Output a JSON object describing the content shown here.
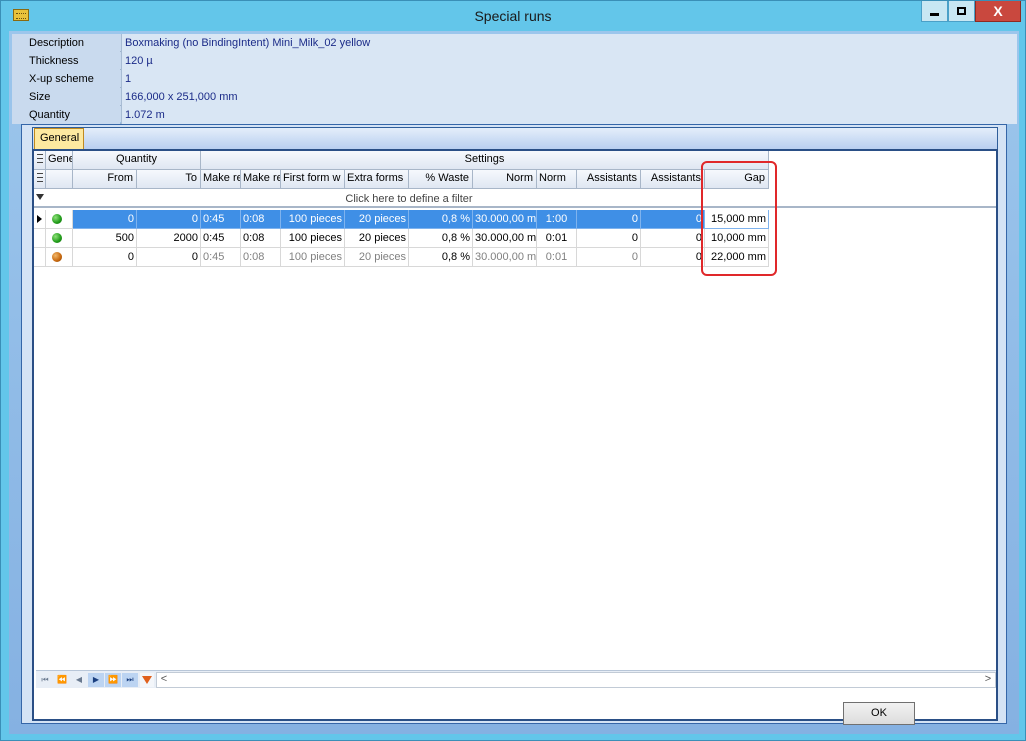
{
  "window": {
    "title": "Special runs",
    "app_icon": "table-icon",
    "close_glyph": "X"
  },
  "properties": [
    {
      "label": "Description",
      "value": "Boxmaking (no BindingIntent) Mini_Milk_02 yellow"
    },
    {
      "label": "Thickness",
      "value": "120 µ"
    },
    {
      "label": "X-up scheme",
      "value": "1"
    },
    {
      "label": "Size",
      "value": "166,000 x 251,000 mm"
    },
    {
      "label": "Quantity",
      "value": "1.072 m"
    }
  ],
  "tabs": [
    {
      "label": "General",
      "active": true
    }
  ],
  "grid": {
    "band_headers": {
      "general": "Gene",
      "quantity": "Quantity",
      "settings": "Settings"
    },
    "columns": [
      "From",
      "To",
      "Make re",
      "Make re",
      "First form w",
      "Extra forms",
      "% Waste",
      "Norm",
      "Norm",
      "Assistants",
      "Assistants",
      "Gap"
    ],
    "filter_placeholder": "Click here to define a filter",
    "rows": [
      {
        "status": "green",
        "selected": true,
        "cells": [
          "0",
          "0",
          "0:45",
          "0:08",
          "100 pieces",
          "20 pieces",
          "0,8 %",
          "30.000,00 m",
          "1:00",
          "0",
          "0",
          "15,000 mm"
        ]
      },
      {
        "status": "green",
        "selected": false,
        "cells": [
          "500",
          "2000",
          "0:45",
          "0:08",
          "100 pieces",
          "20 pieces",
          "0,8 %",
          "30.000,00 m",
          "0:01",
          "0",
          "0",
          "10,000 mm"
        ]
      },
      {
        "status": "orange",
        "selected": false,
        "cells": [
          "0",
          "0",
          "0:45",
          "0:08",
          "100 pieces",
          "20 pieces",
          "0,8 %",
          "30.000,00 m",
          "0:01",
          "0",
          "0",
          "22,000 mm"
        ]
      }
    ]
  },
  "navigator": {
    "buttons": [
      "⏮",
      "⏪",
      "◀",
      "▶",
      "⏩",
      "⏭"
    ],
    "scroll_left": "<",
    "scroll_right": ">"
  },
  "footer": {
    "ok_label": "OK"
  },
  "colors": {
    "titlebar": "#63c6ea",
    "selected_row": "#3f8fe6",
    "highlight_box": "#e0282a",
    "status_green": "#1f9a18",
    "status_orange": "#c6660c"
  }
}
